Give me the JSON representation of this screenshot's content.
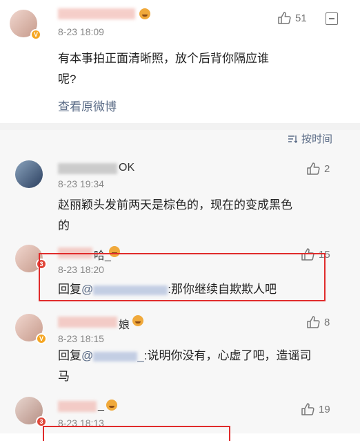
{
  "top_comment": {
    "time": "8-23 18:09",
    "likes": "51",
    "text_line1": "有本事拍正面清晰照，放个后背你隔应谁",
    "text_line2": "呢?",
    "view_original": "查看原微博"
  },
  "sort": {
    "label": "按时间"
  },
  "replies": [
    {
      "name_suffix": "OK",
      "time": "8-23 19:34",
      "likes": "2",
      "text_line1": "赵丽颖头发前两天是棕色的，现在的变成黑色",
      "text_line2": "的"
    },
    {
      "name_suffix": "哈_",
      "time": "8-23 18:20",
      "likes": "15",
      "reply_prefix": "回复",
      "at_sign": "@",
      "reply_text": ":那你继续自欺欺人吧"
    },
    {
      "name_suffix": "娘",
      "time": "8-23 18:15",
      "likes": "8",
      "reply_prefix": "回复",
      "at_sign": "@",
      "at_suffix": "_",
      "reply_text": ":说明你没有，心虚了吧，造谣司",
      "reply_text_line2": "马"
    },
    {
      "name_suffix": "_",
      "time": "8-23 18:13",
      "likes": "19"
    }
  ],
  "colors": {
    "accent_link": "#5a6b86",
    "highlight_box": "#e02b2b"
  }
}
